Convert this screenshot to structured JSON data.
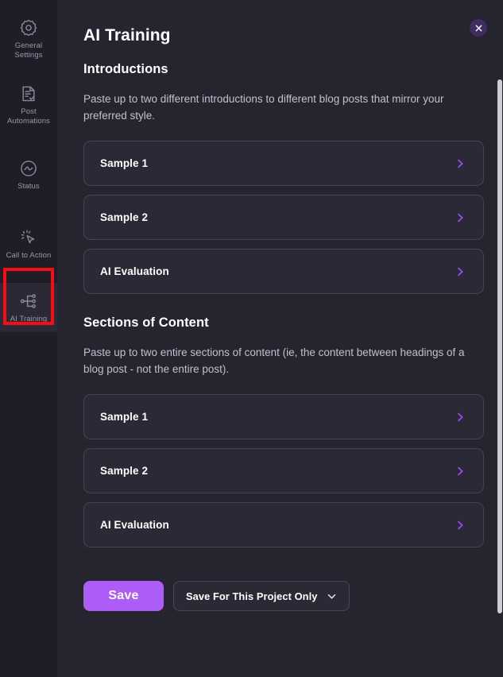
{
  "sidebar": {
    "items": [
      {
        "label": "General Settings",
        "icon": "gear-icon",
        "active": false
      },
      {
        "label": "Post Automations",
        "icon": "document-check-icon",
        "active": false
      },
      {
        "label": "Status",
        "icon": "pulse-circle-icon",
        "active": false
      },
      {
        "label": "Call to Action",
        "icon": "click-cursor-icon",
        "active": false
      },
      {
        "label": "AI Training",
        "icon": "node-graph-icon",
        "active": true
      }
    ]
  },
  "header": {
    "title": "AI Training",
    "close_icon": "close-icon"
  },
  "sections": [
    {
      "title": "Introductions",
      "description": "Paste up to two different introductions to different blog posts that mirror your preferred style.",
      "cards": [
        {
          "label": "Sample 1",
          "chevron": "chevron-right-icon"
        },
        {
          "label": "Sample 2",
          "chevron": "chevron-right-icon"
        },
        {
          "label": "AI Evaluation",
          "chevron": "chevron-right-icon"
        }
      ]
    },
    {
      "title": "Sections of Content",
      "description": "Paste up to two entire sections of content (ie, the content between headings of a blog post - not the entire post).",
      "cards": [
        {
          "label": "Sample 1",
          "chevron": "chevron-right-icon"
        },
        {
          "label": "Sample 2",
          "chevron": "chevron-right-icon"
        },
        {
          "label": "AI Evaluation",
          "chevron": "chevron-right-icon"
        }
      ]
    }
  ],
  "footer": {
    "save_label": "Save",
    "scope_selected": "Save For This Project Only",
    "scope_chevron": "chevron-down-icon"
  },
  "colors": {
    "accent_purple": "#ad5cf7",
    "chevron_purple": "#9b4dff",
    "panel_bg": "#26242f",
    "sidebar_bg": "#1f1d27",
    "card_bg": "#2b2935",
    "card_border": "#46434f",
    "close_bg": "#3f2d60",
    "annotation_red": "#f60d12",
    "scrollbar_thumb": "#cfcdd6"
  }
}
